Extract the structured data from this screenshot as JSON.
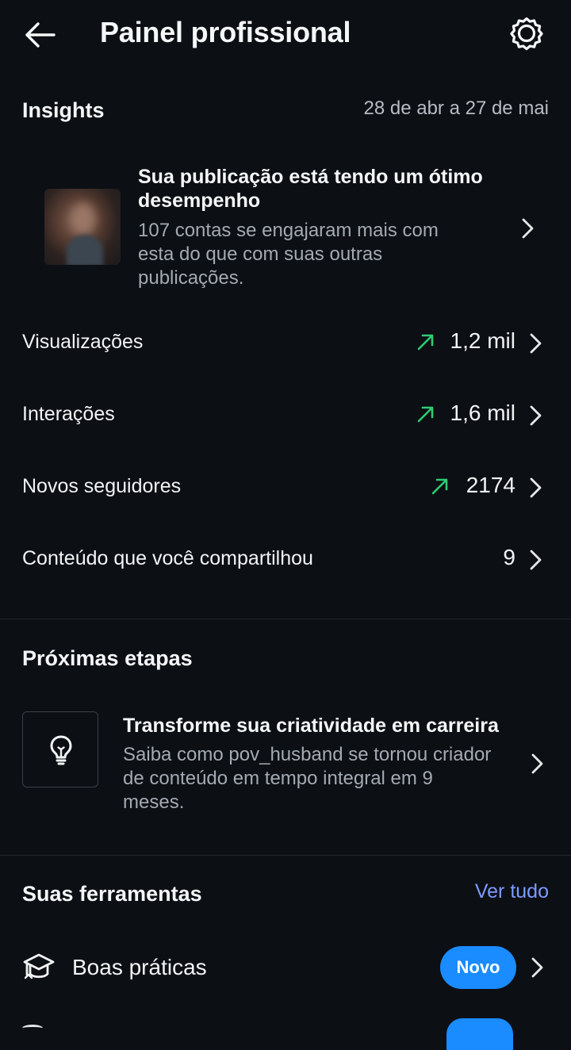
{
  "header": {
    "title": "Painel profissional",
    "back_icon": "arrow-left-icon",
    "settings_icon": "gear-icon"
  },
  "insights": {
    "title": "Insights",
    "date_range": "28 de abr a 27 de mai",
    "highlight": {
      "headline": "Sua publicação está tendo um ótimo desempenho",
      "description": "107 contas se engajaram mais com esta do que com suas outras publicações."
    },
    "metrics": [
      {
        "label": "Visualizações",
        "value": "1,2 mil",
        "trend": "up"
      },
      {
        "label": "Interações",
        "value": "1,6 mil",
        "trend": "up"
      },
      {
        "label": "Novos seguidores",
        "value": "2174",
        "trend": "up"
      },
      {
        "label": "Conteúdo que você compartilhou",
        "value": "9",
        "trend": "none"
      }
    ]
  },
  "next_steps": {
    "title": "Próximas etapas",
    "card": {
      "icon": "lightbulb-icon",
      "headline": "Transforme sua criatividade em carreira",
      "description": "Saiba como pov_husband se tornou criador de conteúdo em tempo integral em 9 meses."
    }
  },
  "tools": {
    "title": "Suas ferramentas",
    "see_all": "Ver tudo",
    "items": [
      {
        "label": "Boas práticas",
        "icon": "graduation-cap-icon",
        "badge": "Novo"
      }
    ]
  },
  "colors": {
    "background": "#0c0f14",
    "trend_up": "#2ecc71",
    "link": "#7c9bff",
    "badge": "#1a8cff"
  }
}
